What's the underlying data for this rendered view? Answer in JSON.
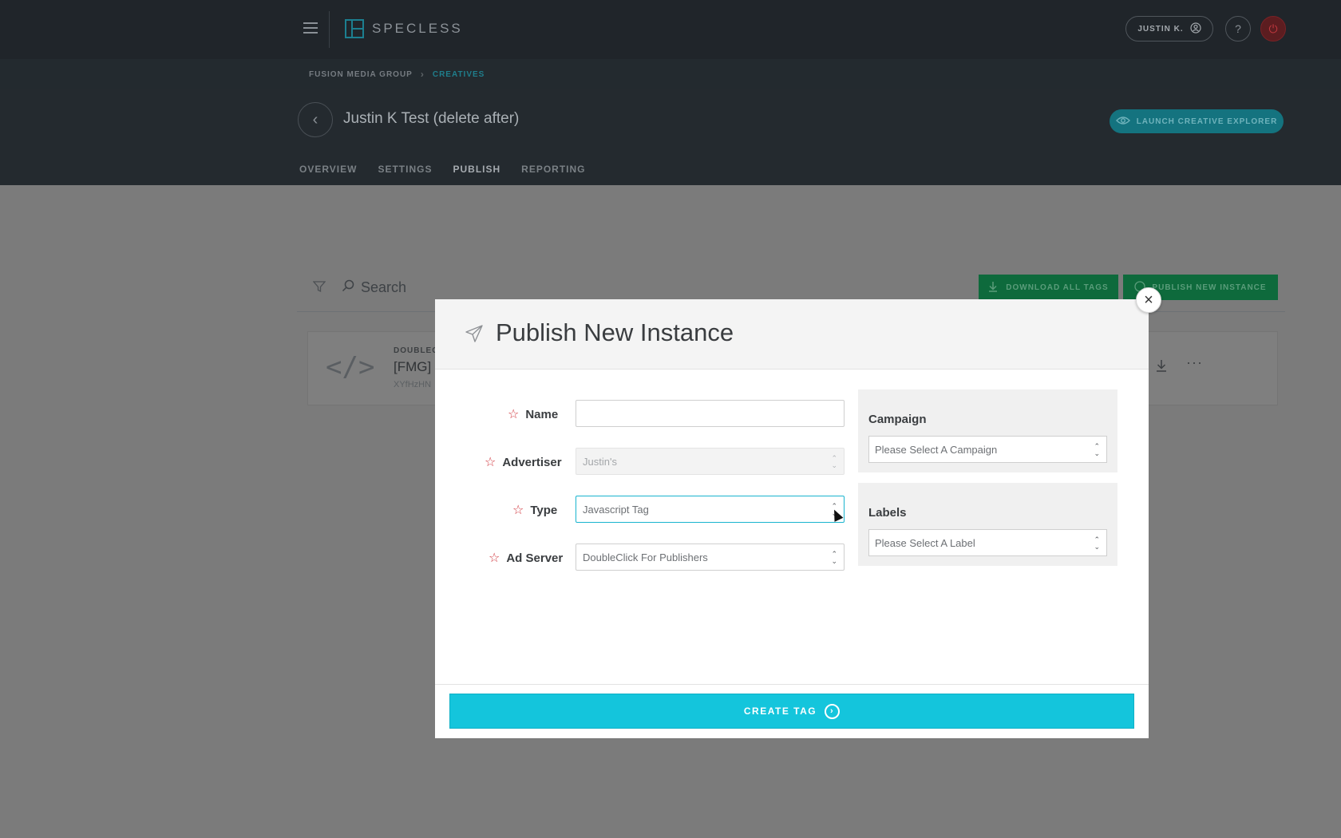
{
  "topbar": {
    "logo_text": "SPECLESS",
    "user_label": "JUSTIN K.",
    "help_icon": "?",
    "power_icon": "⏻"
  },
  "breadcrumb": {
    "items": [
      "FUSION MEDIA GROUP",
      "CREATIVES"
    ],
    "separator": "›"
  },
  "header": {
    "title": "Justin K Test (delete after)",
    "launch_label": "LAUNCH CREATIVE EXPLORER",
    "tabs": [
      {
        "label": "OVERVIEW",
        "active": false
      },
      {
        "label": "SETTINGS",
        "active": false
      },
      {
        "label": "PUBLISH",
        "active": true
      },
      {
        "label": "REPORTING",
        "active": false
      }
    ]
  },
  "toolbar": {
    "search_placeholder": "Search",
    "download_all_label": "DOWNLOAD ALL TAGS",
    "publish_new_label": "PUBLISH NEW INSTANCE"
  },
  "instance_card": {
    "provider": "DOUBLEC",
    "name": "[FMG] ",
    "subtext": "XYfHzHN"
  },
  "modal": {
    "title": "Publish New Instance",
    "fields": {
      "name": {
        "label": "Name",
        "value": ""
      },
      "advertiser": {
        "label": "Advertiser",
        "value": "Justin's"
      },
      "type": {
        "label": "Type",
        "value": "Javascript Tag"
      },
      "ad_server": {
        "label": "Ad Server",
        "value": "DoubleClick For Publishers"
      }
    },
    "campaign": {
      "label": "Campaign",
      "placeholder": "Please Select A Campaign"
    },
    "labels": {
      "label": "Labels",
      "placeholder": "Please Select A Label"
    },
    "create_label": "CREATE TAG"
  },
  "colors": {
    "accent": "#14c5dc",
    "required": "#d0363d",
    "brand_teal": "#1a7483",
    "green": "#0e6a3c"
  }
}
